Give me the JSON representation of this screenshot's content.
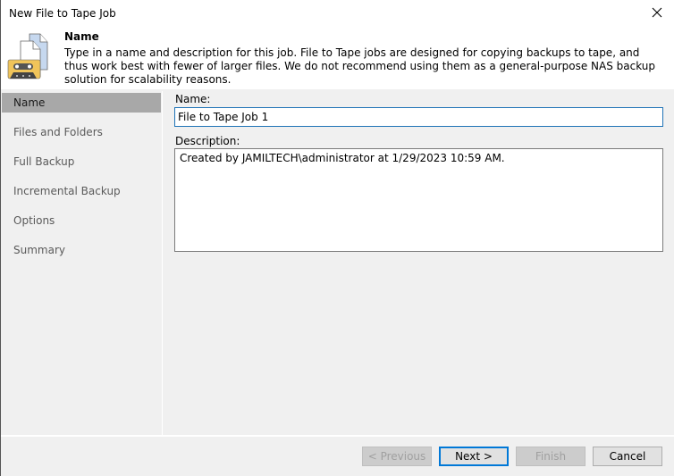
{
  "window": {
    "title": "New File to Tape Job",
    "close_icon": "close-icon"
  },
  "header": {
    "icon": "tape-files-icon",
    "title": "Name",
    "description": "Type in a name and description for this job. File to Tape jobs are designed for copying backups to tape, and thus work best with fewer of larger files. We do not recommend using them as a general-purpose NAS backup solution for scalability reasons."
  },
  "sidebar": {
    "items": [
      {
        "label": "Name",
        "active": true
      },
      {
        "label": "Files and Folders",
        "active": false
      },
      {
        "label": "Full Backup",
        "active": false
      },
      {
        "label": "Incremental Backup",
        "active": false
      },
      {
        "label": "Options",
        "active": false
      },
      {
        "label": "Summary",
        "active": false
      }
    ]
  },
  "form": {
    "name_label": "Name:",
    "name_value": "File to Tape Job 1",
    "description_label": "Description:",
    "description_value": "Created by JAMILTECH\\administrator at 1/29/2023 10:59 AM."
  },
  "buttons": {
    "previous": "< Previous",
    "next": "Next >",
    "finish": "Finish",
    "cancel": "Cancel"
  },
  "colors": {
    "accent": "#0078d7",
    "selected_nav": "#a8a8a8",
    "tape_yellow": "#f0c45a"
  }
}
